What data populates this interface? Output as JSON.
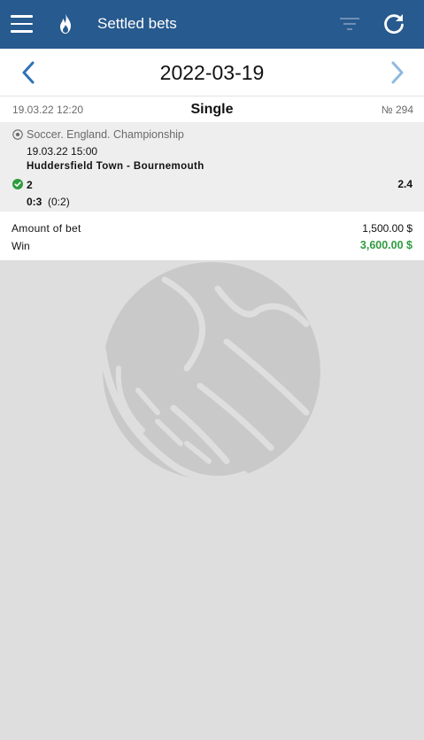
{
  "header": {
    "title": "Settled bets",
    "menu_icon": "hamburger-menu-icon",
    "flame_icon": "flame-icon",
    "filter_icon": "filter-icon",
    "refresh_icon": "refresh-icon",
    "background_color": "#275a8e"
  },
  "date_nav": {
    "date": "2022-03-19",
    "prev_icon": "chevron-left-icon",
    "next_icon": "chevron-right-icon"
  },
  "bet": {
    "datetime": "19.03.22  12:20",
    "type": "Single",
    "number": "№ 294",
    "event": {
      "sport_line": "Soccer. England. Championship",
      "datetime": "19.03.22  15:00",
      "match": "Huddersfield Town - Bournemouth",
      "outcome": "2",
      "coefficient": "2.4",
      "score_main": "0:3",
      "score_half": "(0:2)"
    },
    "amount_label": "Amount of bet",
    "amount_value": "1,500.00 $",
    "win_label": "Win",
    "win_value": "3,600.00 $",
    "win_color": "#2e9c3f"
  }
}
